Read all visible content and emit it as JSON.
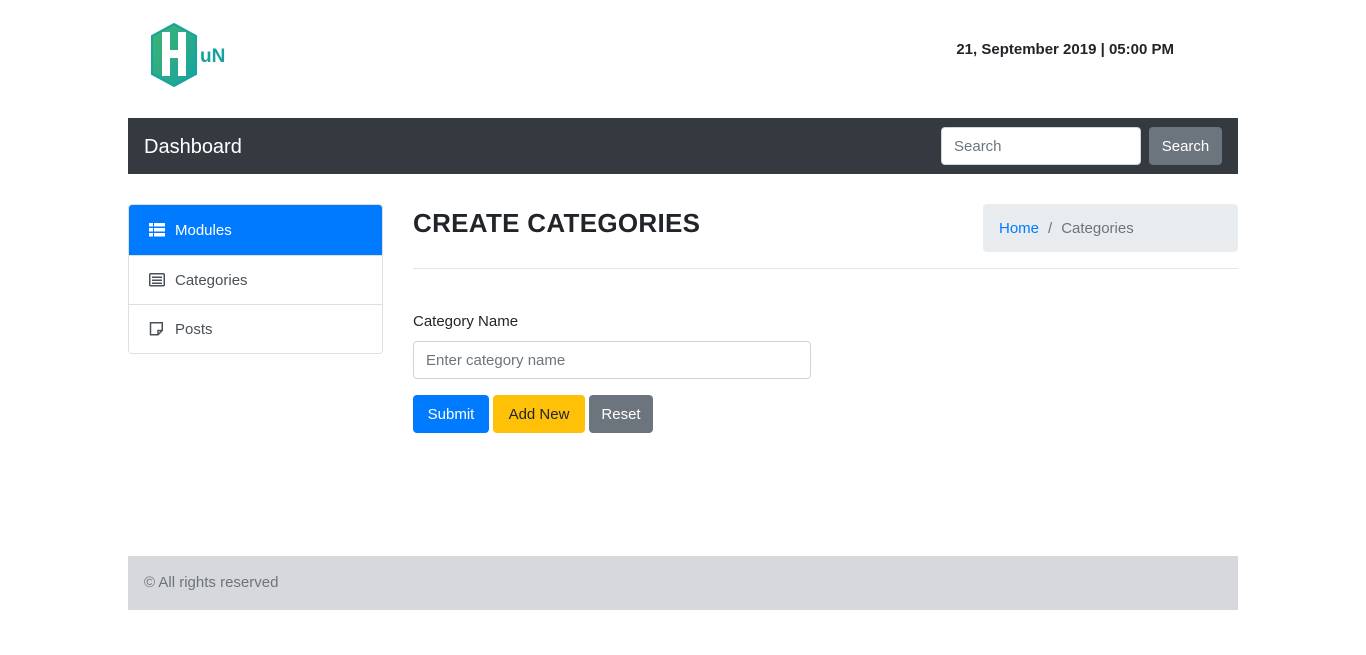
{
  "header": {
    "logo_alt": "HuN",
    "logo_text": "uN",
    "datetime": "21, September 2019 | 05:00 PM"
  },
  "navbar": {
    "brand": "Dashboard",
    "search_placeholder": "Search",
    "search_button": "Search"
  },
  "sidebar": {
    "items": [
      {
        "label": "Modules",
        "icon": "table-icon",
        "active": true
      },
      {
        "label": "Categories",
        "icon": "list-icon",
        "active": false
      },
      {
        "label": "Posts",
        "icon": "note-icon",
        "active": false
      }
    ]
  },
  "main": {
    "title": "CREATE CATEGORIES",
    "breadcrumb": {
      "home": "Home",
      "separator": "/",
      "current": "Categories"
    },
    "form": {
      "label": "Category Name",
      "placeholder": "Enter category name",
      "value": ""
    },
    "buttons": {
      "submit": "Submit",
      "add_new": "Add New",
      "reset": "Reset"
    }
  },
  "footer": {
    "text": "© All rights reserved"
  },
  "colors": {
    "primary": "#007bff",
    "warning": "#ffc107",
    "secondary": "#6c757d",
    "navbar": "#343a40",
    "logo_teal": "#17a2a0",
    "logo_green": "#3fb56e"
  }
}
